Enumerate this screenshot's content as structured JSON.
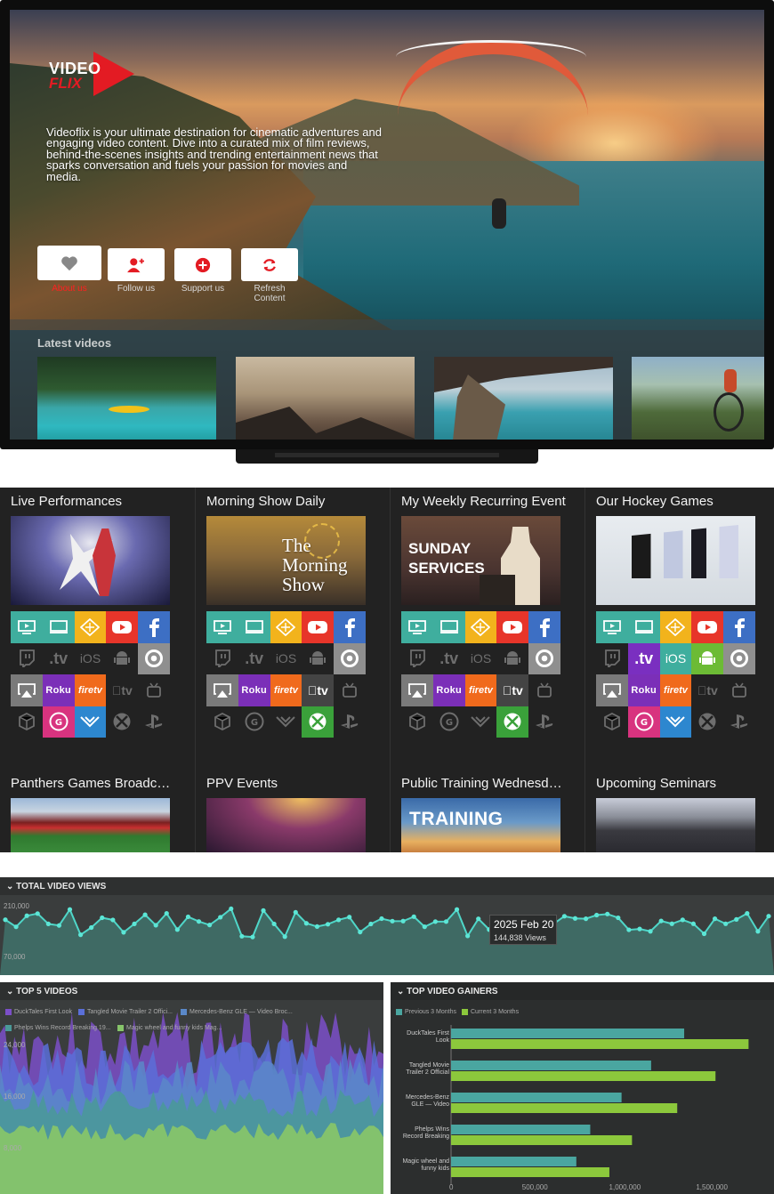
{
  "hero": {
    "logo_line1": "VIDEO",
    "logo_line2": "FLIX",
    "intro": "Videoflix is your ultimate destination for cinematic adventures and engaging video content. Dive into a curated mix of film reviews, behind-the-scenes insights and trending entertainment news that sparks conversation and fuels your passion for movies and media.",
    "buttons": [
      {
        "label": "About us",
        "icon": "heart-icon",
        "active": true
      },
      {
        "label": "Follow us",
        "icon": "add-user-icon",
        "active": false
      },
      {
        "label": "Support us",
        "icon": "plus-circle-icon",
        "active": false
      },
      {
        "label": "Refresh Content",
        "icon": "refresh-icon",
        "active": false
      }
    ],
    "latest_title": "Latest videos",
    "accent": "#e31b23"
  },
  "channels": [
    {
      "title": "Live Performances",
      "thumb_text": "",
      "enabled": [
        "roku-tv",
        "roku-desktop",
        "plex",
        "youtube",
        "facebook",
        "appletv-air",
        "roku",
        "firetv",
        "lg",
        "vizio",
        "chrome-on"
      ]
    },
    {
      "title": "Morning Show Daily",
      "thumb_text": "The Morning Show",
      "enabled": [
        "roku-tv",
        "roku-desktop",
        "plex",
        "youtube",
        "facebook",
        "chrome-on",
        "appletv-air",
        "roku",
        "firetv",
        "appletv",
        "xbox"
      ]
    },
    {
      "title": "My Weekly Recurring Event",
      "thumb_text": "SUNDAY SERVICES",
      "enabled": [
        "roku-tv",
        "roku-desktop",
        "plex",
        "youtube",
        "facebook",
        "chrome-on",
        "appletv-air",
        "roku",
        "firetv",
        "appletv",
        "xbox"
      ]
    },
    {
      "title": "Our Hockey Games",
      "thumb_text": "",
      "enabled": [
        "roku-tv",
        "roku-desktop",
        "plex",
        "youtube",
        "facebook",
        "tv",
        "ios",
        "android",
        "chrome-on",
        "appletv-air",
        "roku",
        "firetv",
        "lg",
        "vizio"
      ]
    }
  ],
  "channels_row2": [
    {
      "title": "Panthers Games Broadc…"
    },
    {
      "title": "PPV Events"
    },
    {
      "title": "Public Training Wednesd…",
      "thumb_text": "TRAINING"
    },
    {
      "title": "Upcoming Seminars"
    }
  ],
  "tile_labels": {
    "tv": ".tv",
    "ios": "iOS",
    "roku": "Roku",
    "firetv": "firetv",
    "appletv": "tv"
  },
  "views_panel": {
    "title": "TOTAL VIDEO VIEWS",
    "y_ticks": [
      "210,000",
      "70,000"
    ],
    "tooltip_date": "2025 Feb 20",
    "tooltip_value": "144,838 Views"
  },
  "top5_panel": {
    "title": "TOP 5 VIDEOS",
    "legend": [
      {
        "name": "DuckTales First Look",
        "color": "#7b4fc8"
      },
      {
        "name": "Tangled Movie Trailer 2 Offici...",
        "color": "#5a6fd8"
      },
      {
        "name": "Mercedes-Benz GLE — Video Broc...",
        "color": "#5a88c8"
      },
      {
        "name": "Phelps Wins Record Breaking 19...",
        "color": "#4a9a98"
      },
      {
        "name": "Magic wheel and funny kids Mag...",
        "color": "#86c46a"
      }
    ],
    "y_ticks": [
      "24,000",
      "16,000",
      "8,000"
    ]
  },
  "chart_data": {
    "type": "bar",
    "title": "TOP VIDEO GAINERS",
    "categories": [
      "DuckTales First Look",
      "Tangled Movie Trailer 2 Official",
      "Mercedes-Benz GLE — Video",
      "Phelps Wins Record Breaking",
      "Magic wheel and funny kids"
    ],
    "series": [
      {
        "name": "Previous 3 Months",
        "color": "#4aa6a0",
        "values": [
          1340000,
          1150000,
          980000,
          800000,
          720000
        ]
      },
      {
        "name": "Current 3 Months",
        "color": "#8cc83c",
        "values": [
          1710000,
          1520000,
          1300000,
          1040000,
          910000
        ]
      }
    ],
    "x_ticks": [
      "0",
      "500,000",
      "1,000,000",
      "1,500,000"
    ],
    "xlim": [
      0,
      1800000
    ]
  }
}
